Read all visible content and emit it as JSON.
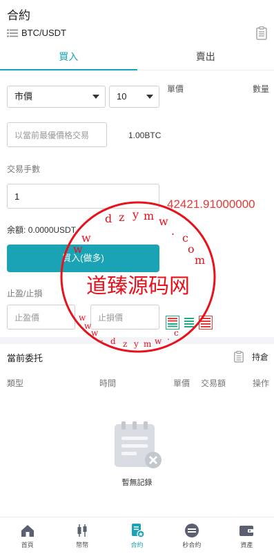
{
  "header": {
    "title": "合約",
    "pair": "BTC/USDT"
  },
  "tabs": [
    {
      "label": "買入",
      "active": true
    },
    {
      "label": "賣出",
      "active": false
    }
  ],
  "form": {
    "order_type_selected": "市價",
    "leverage_selected": "10",
    "price_placeholder": "以當前最優價格交易",
    "amount_display": "1.00BTC",
    "lots_label": "交易手數",
    "lots_value": "1",
    "balance_label": "余額:",
    "balance_value": "0.0000USDT",
    "buy_button_label": "買入(做多)",
    "tp_sl_label": "止盈/止損",
    "tp_placeholder": "止盈價",
    "sl_placeholder": "止損價"
  },
  "orderbook": {
    "price_header": "單價",
    "qty_header": "數量",
    "last_price": "42421.91000000"
  },
  "orders": {
    "title": "當前委托",
    "holdings_label": "持倉",
    "columns": [
      "類型",
      "時間",
      "單價",
      "交易額",
      "操作"
    ],
    "empty_text": "暫無記錄"
  },
  "nav": [
    {
      "label": "首頁",
      "icon": "home-icon",
      "active": false
    },
    {
      "label": "幣幣",
      "icon": "candlestick-icon",
      "active": false
    },
    {
      "label": "合約",
      "icon": "contract-icon",
      "active": true
    },
    {
      "label": "秒合約",
      "icon": "seconds-contract-icon",
      "active": false
    },
    {
      "label": "資產",
      "icon": "wallet-icon",
      "active": false
    }
  ],
  "watermark": {
    "main": "道臻源码网",
    "top_letters": [
      "w",
      "w",
      "d",
      "z",
      "y",
      "m",
      "w",
      ".",
      "c",
      "o",
      "m"
    ],
    "bottom_letters": [
      "w",
      "w",
      "w",
      ".",
      "d",
      "z",
      "y",
      "m",
      "w",
      ".",
      "c"
    ]
  },
  "colors": {
    "accent": "#1aa3b5",
    "red": "#e53935",
    "watermark": "#e8111c"
  }
}
